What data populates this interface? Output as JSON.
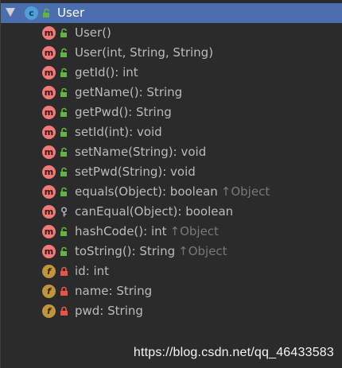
{
  "tree": {
    "root": {
      "label": "User",
      "icon": "class-icon",
      "badge_text": "c"
    },
    "members": [
      {
        "kind": "method",
        "badge_text": "m",
        "visibility": "public",
        "label": "User()",
        "inherited": ""
      },
      {
        "kind": "method",
        "badge_text": "m",
        "visibility": "public",
        "label": "User(int, String, String)",
        "inherited": ""
      },
      {
        "kind": "method",
        "badge_text": "m",
        "visibility": "public",
        "label": "getId(): int",
        "inherited": ""
      },
      {
        "kind": "method",
        "badge_text": "m",
        "visibility": "public",
        "label": "getName(): String",
        "inherited": ""
      },
      {
        "kind": "method",
        "badge_text": "m",
        "visibility": "public",
        "label": "getPwd(): String",
        "inherited": ""
      },
      {
        "kind": "method",
        "badge_text": "m",
        "visibility": "public",
        "label": "setId(int): void",
        "inherited": ""
      },
      {
        "kind": "method",
        "badge_text": "m",
        "visibility": "public",
        "label": "setName(String): void",
        "inherited": ""
      },
      {
        "kind": "method",
        "badge_text": "m",
        "visibility": "public",
        "label": "setPwd(String): void",
        "inherited": ""
      },
      {
        "kind": "method",
        "badge_text": "m",
        "visibility": "public",
        "label": "equals(Object): boolean",
        "inherited": "↑Object"
      },
      {
        "kind": "method",
        "badge_text": "m",
        "visibility": "protected",
        "label": "canEqual(Object): boolean",
        "inherited": ""
      },
      {
        "kind": "method",
        "badge_text": "m",
        "visibility": "public",
        "label": "hashCode(): int",
        "inherited": "↑Object"
      },
      {
        "kind": "method",
        "badge_text": "m",
        "visibility": "public",
        "label": "toString(): String",
        "inherited": "↑Object"
      },
      {
        "kind": "field",
        "badge_text": "f",
        "visibility": "private",
        "label": "id: int",
        "inherited": ""
      },
      {
        "kind": "field",
        "badge_text": "f",
        "visibility": "private",
        "label": "name: String",
        "inherited": ""
      },
      {
        "kind": "field",
        "badge_text": "f",
        "visibility": "private",
        "label": "pwd: String",
        "inherited": ""
      }
    ]
  },
  "colors": {
    "background": "#2b2b2b",
    "selection": "#4b6eaf",
    "method_badge": "#f07a78",
    "field_badge": "#c0963c",
    "class_badge": "#4fa0d8",
    "public_lock": "#62b543",
    "private_lock": "#e0584c",
    "inherited_text": "#787878"
  },
  "watermark": "https://blog.csdn.net/qq_46433583"
}
